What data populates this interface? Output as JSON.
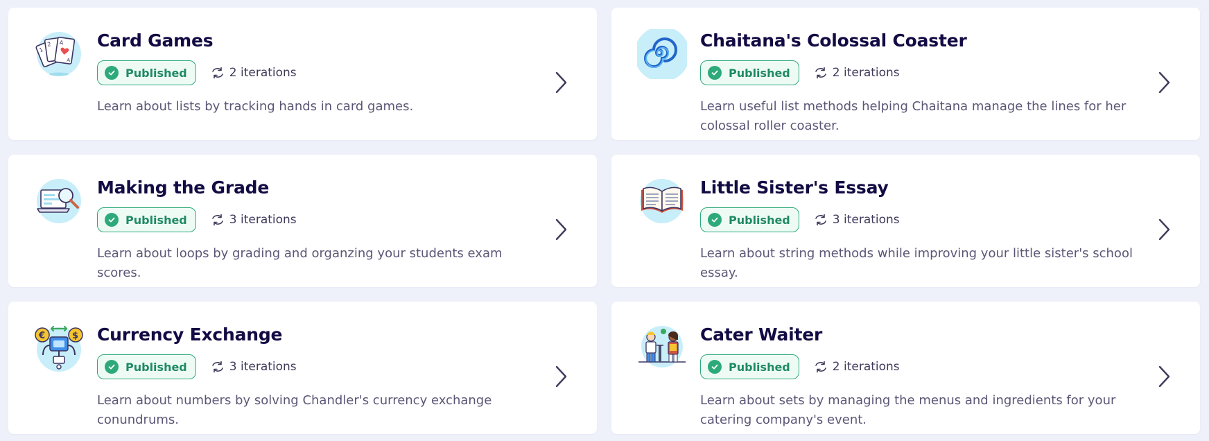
{
  "colors": {
    "background": "#eef1fa",
    "card": "#ffffff",
    "title": "#130b43",
    "published": "#2ea97a",
    "icon_circle": "#c8eef9"
  },
  "cards": [
    {
      "title": "Card Games",
      "status": "Published",
      "iterations": "2 iterations",
      "description": "Learn about lists by tracking hands in card games.",
      "icon": "playing-cards-icon"
    },
    {
      "title": "Chaitana's Colossal Coaster",
      "status": "Published",
      "iterations": "2 iterations",
      "description": "Learn useful list methods helping Chaitana manage the lines for her colossal roller coaster.",
      "icon": "spiral-coaster-icon"
    },
    {
      "title": "Making the Grade",
      "status": "Published",
      "iterations": "3 iterations",
      "description": "Learn about loops by grading and organzing your students exam scores.",
      "icon": "magnifier-laptop-icon"
    },
    {
      "title": "Little Sister's Essay",
      "status": "Published",
      "iterations": "3 iterations",
      "description": "Learn about string methods while improving your little sister's school essay.",
      "icon": "open-book-icon"
    },
    {
      "title": "Currency Exchange",
      "status": "Published",
      "iterations": "3 iterations",
      "description": "Learn about numbers by solving Chandler's currency exchange conundrums.",
      "icon": "currency-robot-icon"
    },
    {
      "title": "Cater Waiter",
      "status": "Published",
      "iterations": "2 iterations",
      "description": "Learn about sets by managing the menus and ingredients for your catering company's event.",
      "icon": "waiters-icon"
    }
  ]
}
